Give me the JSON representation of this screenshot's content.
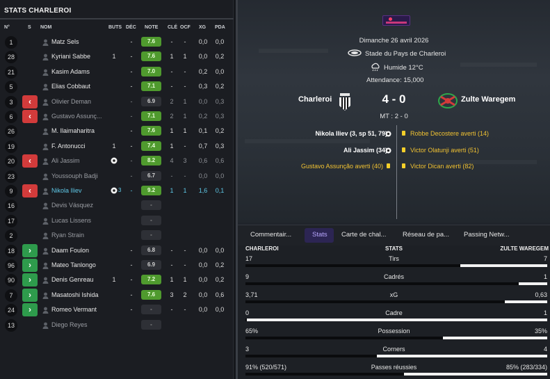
{
  "left": {
    "title": "STATS CHARLEROI",
    "headers": [
      "N°",
      "S",
      "NOM",
      "BUTS",
      "DÉC",
      "NOTE",
      "CLÉ",
      "OCF",
      "XG",
      "PDA"
    ],
    "players": [
      {
        "num": "1",
        "sub": "",
        "name": "Matz Sels",
        "buts": "",
        "dec": "-",
        "note": "7.6",
        "rate": "g",
        "cle": "-",
        "ocf": "-",
        "xg": "0,0",
        "pda": "0,0",
        "state": ""
      },
      {
        "num": "28",
        "sub": "",
        "name": "Kyriani Sabbe",
        "buts": "1",
        "dec": "-",
        "note": "7.6",
        "rate": "g",
        "cle": "1",
        "ocf": "1",
        "xg": "0,0",
        "pda": "0,2",
        "state": ""
      },
      {
        "num": "21",
        "sub": "",
        "name": "Kasim Adams",
        "buts": "",
        "dec": "-",
        "note": "7.0",
        "rate": "g",
        "cle": "-",
        "ocf": "-",
        "xg": "0,2",
        "pda": "0,0",
        "state": ""
      },
      {
        "num": "5",
        "sub": "",
        "name": "Elias Cobbaut",
        "buts": "",
        "dec": "-",
        "note": "7.1",
        "rate": "g",
        "cle": "-",
        "ocf": "-",
        "xg": "0,3",
        "pda": "0,2",
        "state": ""
      },
      {
        "num": "3",
        "sub": "out",
        "name": "Olivier Deman",
        "buts": "",
        "dec": "-",
        "note": "6.9",
        "rate": "n",
        "cle": "2",
        "ocf": "1",
        "xg": "0,0",
        "pda": "0,3",
        "state": "dim"
      },
      {
        "num": "6",
        "sub": "out",
        "name": "Gustavo Assunç...",
        "buts": "",
        "dec": "-",
        "note": "7.1",
        "rate": "g",
        "cle": "2",
        "ocf": "1",
        "xg": "0,2",
        "pda": "0,3",
        "state": "dim"
      },
      {
        "num": "26",
        "sub": "",
        "name": "M. Ilaimaharitra",
        "buts": "",
        "dec": "-",
        "note": "7.6",
        "rate": "g",
        "cle": "1",
        "ocf": "1",
        "xg": "0,1",
        "pda": "0,2",
        "state": ""
      },
      {
        "num": "19",
        "sub": "",
        "name": "F. Antonucci",
        "buts": "1",
        "dec": "-",
        "note": "7.4",
        "rate": "g",
        "cle": "1",
        "ocf": "-",
        "xg": "0,7",
        "pda": "0,3",
        "state": ""
      },
      {
        "num": "20",
        "sub": "out",
        "name": "Ali Jassim",
        "buts": "ball",
        "dec": "-",
        "note": "8.2",
        "rate": "g",
        "cle": "4",
        "ocf": "3",
        "xg": "0,6",
        "pda": "0,6",
        "state": "dim"
      },
      {
        "num": "23",
        "sub": "",
        "name": "Youssouph Badji",
        "buts": "",
        "dec": "-",
        "note": "6.7",
        "rate": "n",
        "cle": "-",
        "ocf": "-",
        "xg": "0,0",
        "pda": "0,0",
        "state": "dim"
      },
      {
        "num": "9",
        "sub": "out",
        "name": "Nikola Iliev",
        "buts": "ball3",
        "dec": "-",
        "note": "9.2",
        "rate": "g",
        "cle": "1",
        "ocf": "1",
        "xg": "1,6",
        "pda": "0,1",
        "state": "hl"
      },
      {
        "num": "16",
        "sub": "",
        "name": "Devis Vásquez",
        "buts": "",
        "dec": "",
        "note": "-",
        "rate": "e",
        "cle": "",
        "ocf": "",
        "xg": "",
        "pda": "",
        "state": "dim"
      },
      {
        "num": "17",
        "sub": "",
        "name": "Lucas Lissens",
        "buts": "",
        "dec": "",
        "note": "-",
        "rate": "e",
        "cle": "",
        "ocf": "",
        "xg": "",
        "pda": "",
        "state": "dim"
      },
      {
        "num": "2",
        "sub": "",
        "name": "Ryan Strain",
        "buts": "",
        "dec": "",
        "note": "-",
        "rate": "e",
        "cle": "",
        "ocf": "",
        "xg": "",
        "pda": "",
        "state": "dim"
      },
      {
        "num": "18",
        "sub": "in",
        "name": "Daam Foulon",
        "buts": "",
        "dec": "-",
        "note": "6.8",
        "rate": "n",
        "cle": "-",
        "ocf": "-",
        "xg": "0,0",
        "pda": "0,0",
        "state": ""
      },
      {
        "num": "96",
        "sub": "in",
        "name": "Mateo Tanlongo",
        "buts": "",
        "dec": "-",
        "note": "6.9",
        "rate": "n",
        "cle": "-",
        "ocf": "-",
        "xg": "0,0",
        "pda": "0,2",
        "state": ""
      },
      {
        "num": "90",
        "sub": "in",
        "name": "Denis Genreau",
        "buts": "1",
        "dec": "-",
        "note": "7.2",
        "rate": "g",
        "cle": "1",
        "ocf": "1",
        "xg": "0,0",
        "pda": "0,2",
        "state": ""
      },
      {
        "num": "7",
        "sub": "in",
        "name": "Masatoshi Ishida",
        "buts": "",
        "dec": "-",
        "note": "7.6",
        "rate": "g",
        "cle": "3",
        "ocf": "2",
        "xg": "0,0",
        "pda": "0,6",
        "state": ""
      },
      {
        "num": "24",
        "sub": "in",
        "name": "Romeo Vermant",
        "buts": "",
        "dec": "-",
        "note": "-",
        "rate": "e",
        "cle": "-",
        "ocf": "-",
        "xg": "0,0",
        "pda": "0,0",
        "state": ""
      },
      {
        "num": "13",
        "sub": "",
        "name": "Diego Reyes",
        "buts": "",
        "dec": "",
        "note": "-",
        "rate": "e",
        "cle": "",
        "ocf": "",
        "xg": "",
        "pda": "",
        "state": "dim"
      }
    ]
  },
  "match": {
    "date": "Dimanche 26 avril 2026",
    "stadium": "Stade du Pays de Charleroi",
    "weather": "Humide 12°C",
    "attendance": "Attendance: 15,000",
    "home": "Charleroi",
    "away": "Zulte Waregem",
    "score": "4 - 0",
    "halftime": "MT : 2 - 0",
    "home_events": [
      {
        "text": "Nikola Iliev (3, sp 51, 79)",
        "kind": "goal"
      },
      {
        "text": "Ali Jassim (34)",
        "kind": "goal"
      },
      {
        "text": "Gustavo Assunção averti (40)",
        "kind": "yellow"
      }
    ],
    "away_events": [
      {
        "text": "Robbe Decostere averti (14)",
        "kind": "yellow"
      },
      {
        "text": "Victor Olatunji averti (51)",
        "kind": "yellow"
      },
      {
        "text": "Victor Dican averti (82)",
        "kind": "yellow"
      }
    ]
  },
  "tabs": [
    "Commentair...",
    "Stats",
    "Carte de chal...",
    "Réseau de pa...",
    "Passing Netw..."
  ],
  "stats": {
    "home_header": "CHARLEROI",
    "mid_header": "STATS",
    "away_header": "ZULTE WAREGEM",
    "rows": [
      {
        "label": "Tirs",
        "home": "17",
        "away": "7",
        "home_frac": 0.708
      },
      {
        "label": "Cadrés",
        "home": "9",
        "away": "1",
        "home_frac": 0.9
      },
      {
        "label": "xG",
        "home": "3,71",
        "away": "0,63",
        "home_frac": 0.855
      },
      {
        "label": "Cadre",
        "home": "0",
        "away": "1",
        "home_frac": 0.0
      },
      {
        "label": "Possession",
        "home": "65%",
        "away": "35%",
        "home_frac": 0.65
      },
      {
        "label": "Corners",
        "home": "3",
        "away": "4",
        "home_frac": 0.43
      },
      {
        "label": "Passes réussies",
        "home": "91% (520/571)",
        "away": "85% (283/334)",
        "home_frac": 0.52
      }
    ]
  }
}
